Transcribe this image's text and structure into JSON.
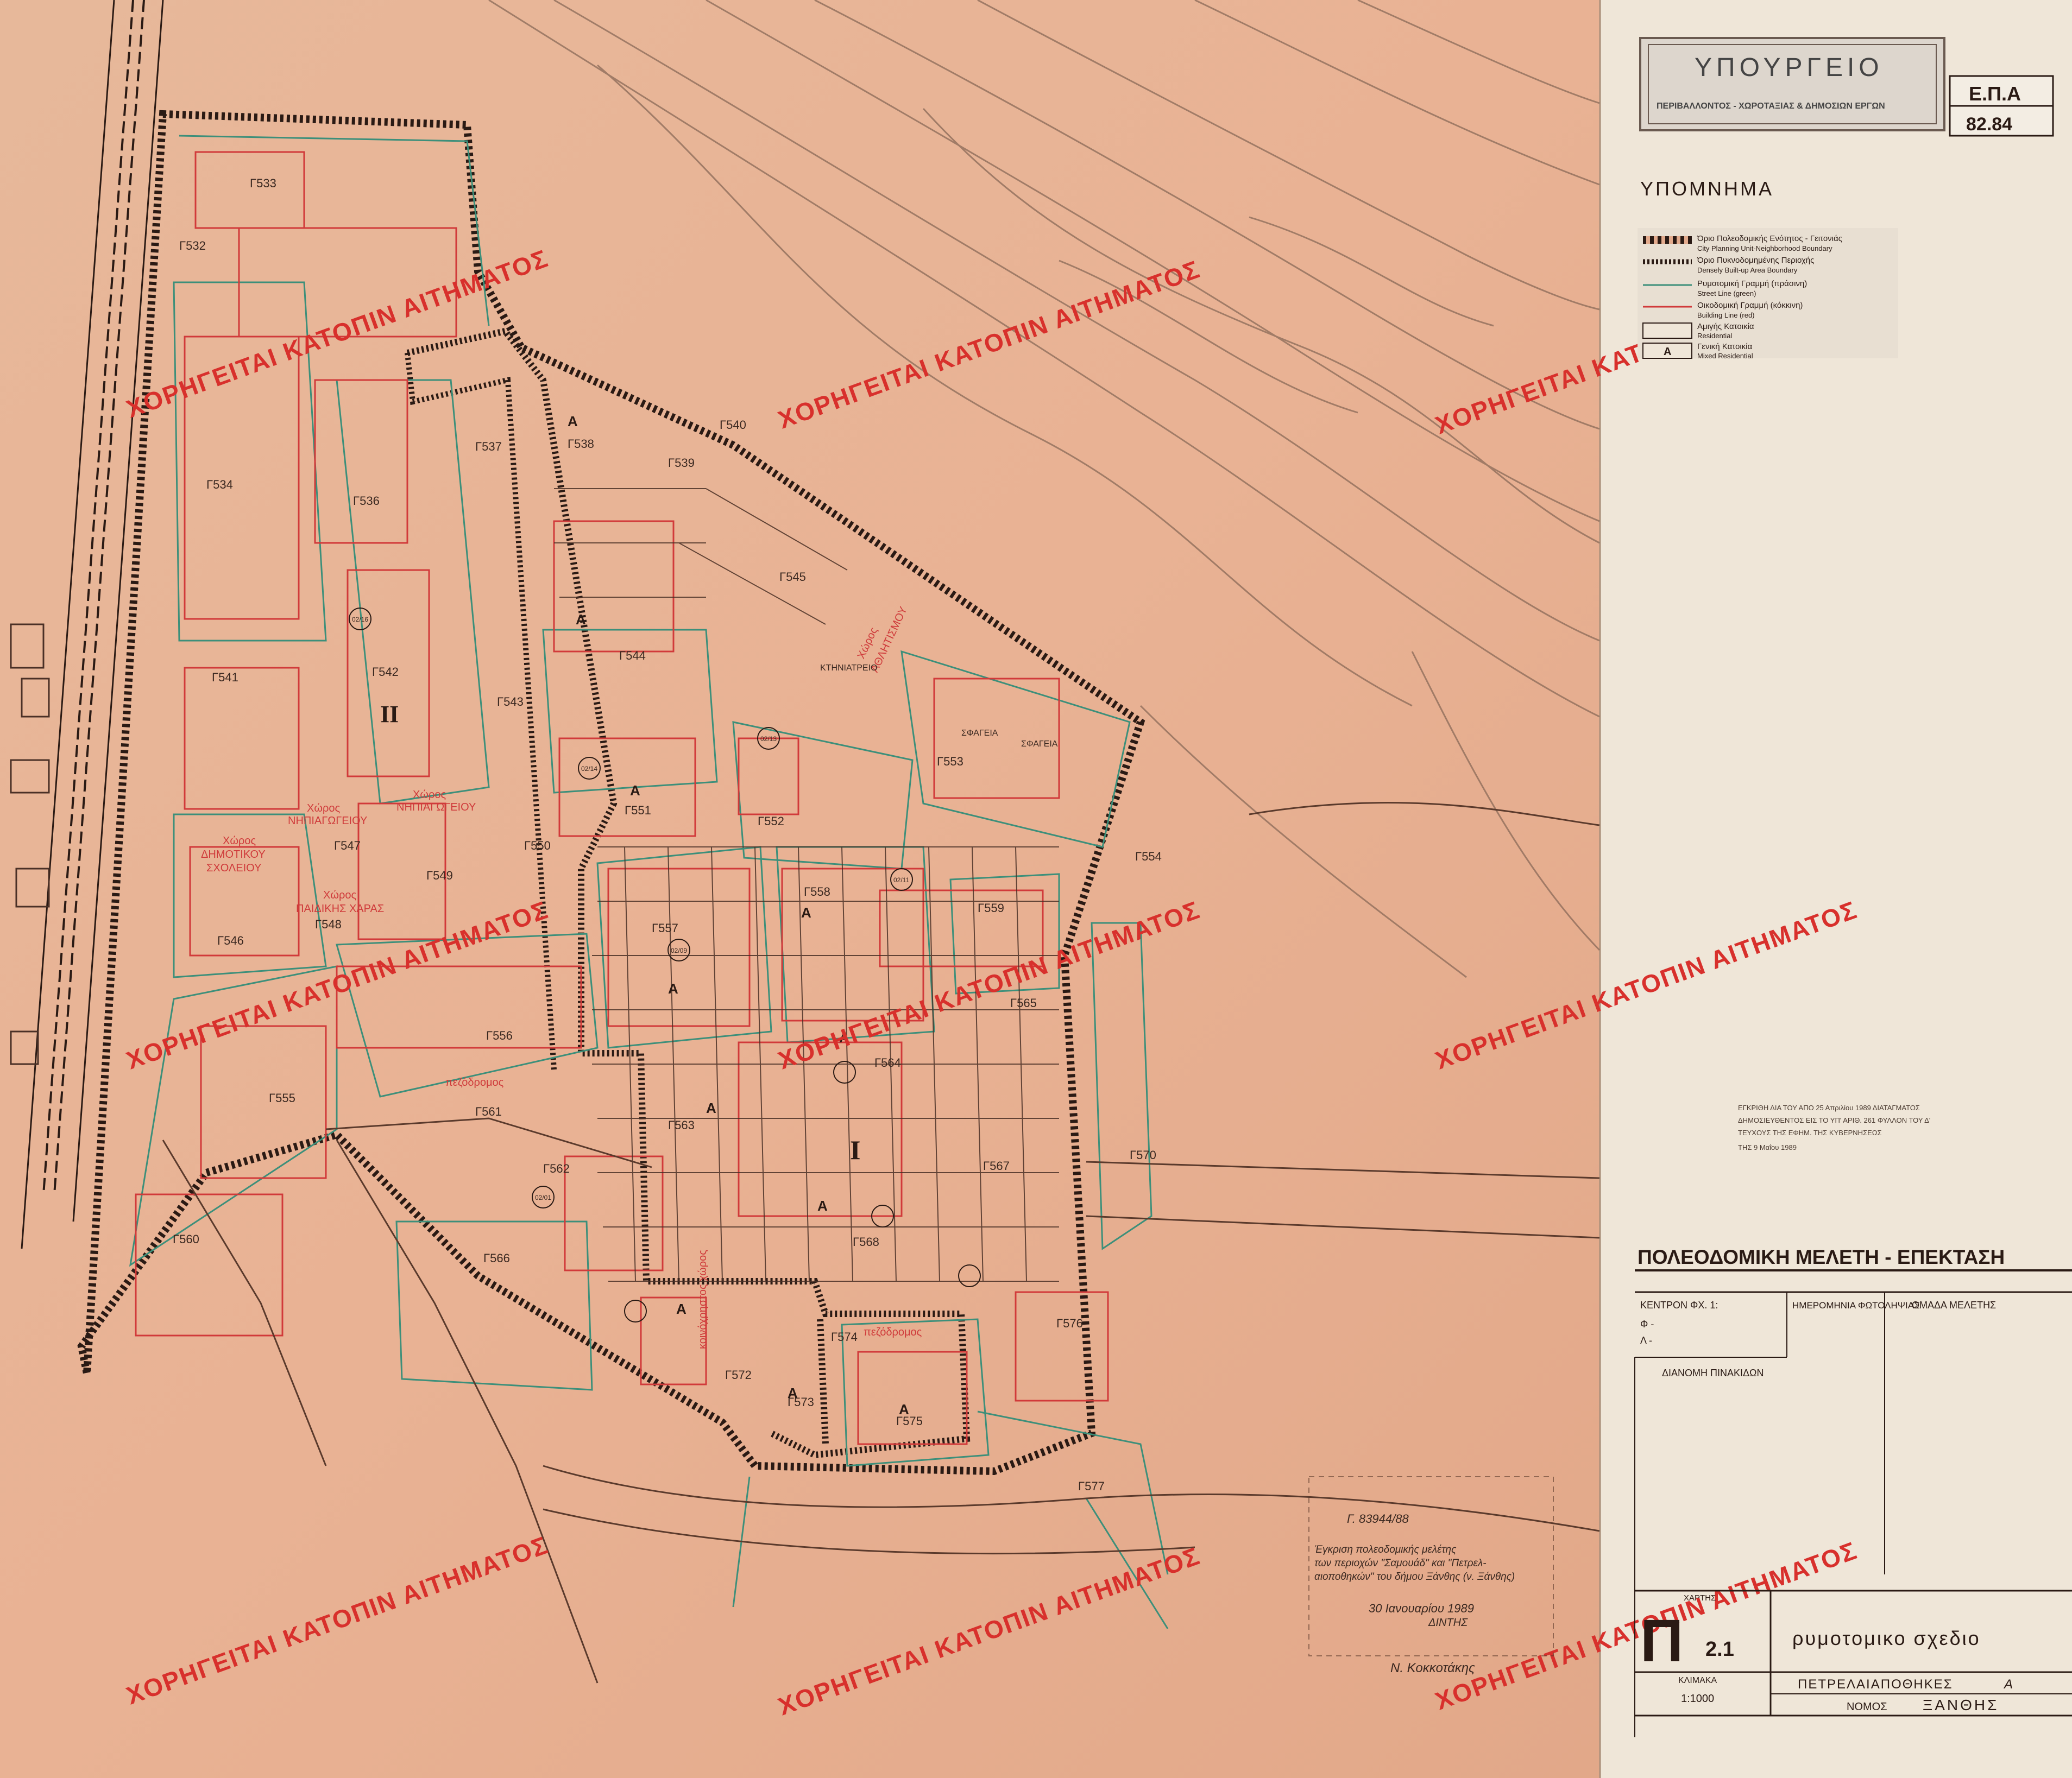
{
  "stamp": {
    "line1": "ΥΠΟΥΡΓΕΙΟ",
    "line2": "ΠΕΡΙΒΑΛΛΟΝΤΟΣ - ΧΩΡΟΤΑΞΙΑΣ & ΔΗΜΟΣΙΩΝ ΕΡΓΩΝ"
  },
  "epa": {
    "code": "Ε.Π.Α",
    "year": "82.84"
  },
  "legend": {
    "title": "ΥΠΟΜΝΗΜΑ",
    "items": [
      {
        "gr": "Όριο Πολεοδομικής Ενότητος - Γειτονιάς",
        "en": "City Planning Unit-Neighborhood Boundary",
        "swatch": "hatched"
      },
      {
        "gr": "Όριο Πυκνοδομημένης Περιοχής",
        "en": "Densely Built-up Area Boundary",
        "swatch": "thick"
      },
      {
        "gr": "Ρυμοτομική Γραμμή (πράσινη)",
        "en": "Street Line (green)",
        "swatch": "thin"
      },
      {
        "gr": "Οικοδομική Γραμμή (κόκκινη)",
        "en": "Building Line (red)",
        "swatch": "thin2"
      },
      {
        "gr": "Αμιγής Κατοικία",
        "en": "Residential",
        "swatch": "box"
      },
      {
        "gr": "Γενική Κατοικία",
        "en": "Mixed Residential",
        "swatch": "A"
      }
    ],
    "swatch_letter": "A"
  },
  "approval": {
    "line1": "ΕΓΚΡΙΘΗ ΔΙΑ ΤΟΥ ΑΠΟ 25 Απριλίου 1989 ΔΙΑΤΑΓΜΑΤΟΣ",
    "line2": "ΔΗΜΟΣΙΕΥΘΕΝΤΟΣ ΕΙΣ ΤΟ ΥΠ' ΑΡΙΘ. 261 ΦΥΛΛΟΝ ΤΟΥ Δ'",
    "line3": "ΤΕΥΧΟΥΣ ΤΗΣ ΕΦΗΜ. ΤΗΣ ΚΥΒΕΡΝΗΣΕΩΣ",
    "line4": "ΤΗΣ 9 Μαΐου 1989"
  },
  "titleblock": {
    "heading": "ΠΟΛΕΟΔΟΜΙΚΗ ΜΕΛΕΤΗ - ΕΠΕΚΤΑΣΗ",
    "kentron": "ΚΕΝΤΡΟΝ ΦΧ. 1:",
    "phi": "Φ -",
    "lambda": "Λ -",
    "date_label": "ΗΜΕΡΟΜΗΝΙΑ ΦΩΤΟΛΗΨΙΑΣ",
    "team_label": "ΟΜΑΔΑ ΜΕΛΕΤΗΣ",
    "distribution": "ΔΙΑΝΟΜΗ ΠΙΝΑΚΙΔΩΝ",
    "map_label": "ΧΑΡΤΗΣ",
    "map_letter": "Π",
    "map_number": "2.1",
    "map_title": "ρυμοτομικο σχεδιο",
    "scale_label": "ΚΛΙΜΑΚΑ",
    "scale_value": "1:1000",
    "area": "ΠΕΤΡΕΛΑΙΑΠΟΘΗΚΕΣ",
    "area_mark": "Α",
    "nomos_label": "ΝΟΜΟΣ",
    "nomos_value": "ΞΑΝΘΗΣ"
  },
  "note": {
    "ref": "Γ. 83944/88",
    "text1": "Έγκριση πολεοδομικής μελέτης",
    "text2": "των περιοχών \"Σαμουάδ\" και \"Πετρελ-",
    "text3": "αιοποθηκών\" του δήμου Ξάνθης (ν. Ξάνθης)",
    "date": "30 Ιανουαρίου 1989",
    "role": "ΔΙΝΤΗΣ",
    "signer": "Ν. Κοκκοτάκης"
  },
  "watermark": "ΧΟΡΗΓΕΙΤΑΙ ΚΑΤΟΠΙΝ ΑΙΤΗΜΑΤΟΣ",
  "zones": {
    "one": "I",
    "two": "II"
  },
  "blocks": [
    "Γ533",
    "Γ532",
    "Γ534",
    "Γ536",
    "Γ537",
    "Γ538",
    "Γ539",
    "Γ540",
    "Γ541",
    "Γ542",
    "Γ543",
    "Γ544",
    "Γ545",
    "Γ546",
    "Γ547",
    "Γ548",
    "Γ549",
    "Γ550",
    "Γ551",
    "Γ552",
    "Γ553",
    "Γ554",
    "Γ555",
    "Γ556",
    "Γ557",
    "Γ558",
    "Γ559",
    "Γ560",
    "Γ561",
    "Γ562",
    "Γ563",
    "Γ564",
    "Γ565",
    "Γ566",
    "Γ567",
    "Γ568",
    "Γ570",
    "Γ572",
    "Γ573",
    "Γ574",
    "Γ575",
    "Γ576",
    "Γ577"
  ],
  "red_labels": {
    "school1": "Χώρος",
    "school2": "ΔΗΜΟΤΙΚΟΥ",
    "school3": "ΣΧΟΛΕΙΟΥ",
    "kinder1": "Χώρος",
    "kinder2": "ΝΗΠΙΑΓΩΓΕΙΟΥ",
    "play1": "Χώρος",
    "play2": "ΠΑΙΔΙΚΗΣ ΧΑΡΑΣ",
    "sport1": "Χώρος",
    "sport2": "ΑΘΛΗΤΙΣΜΟΥ",
    "green": "κοινόχρηστος χώρος",
    "walk": "πεζόδρομος",
    "vet": "ΚΤΗΝΙΑΤΡΕΙΟ",
    "warehouse1": "ΣΦΑΓΕΙΑ",
    "warehouse2": "ΣΦΑΓΕΙΑ"
  },
  "small_codes": [
    "02/16",
    "02/14",
    "02/13",
    "02/09",
    "02/11",
    "02/15",
    "02/12",
    "02/10",
    "02/08",
    "02/07",
    "02/01",
    "02/03",
    "02/02",
    "02/04",
    "02/05",
    "02/06"
  ],
  "widths": "6.00"
}
